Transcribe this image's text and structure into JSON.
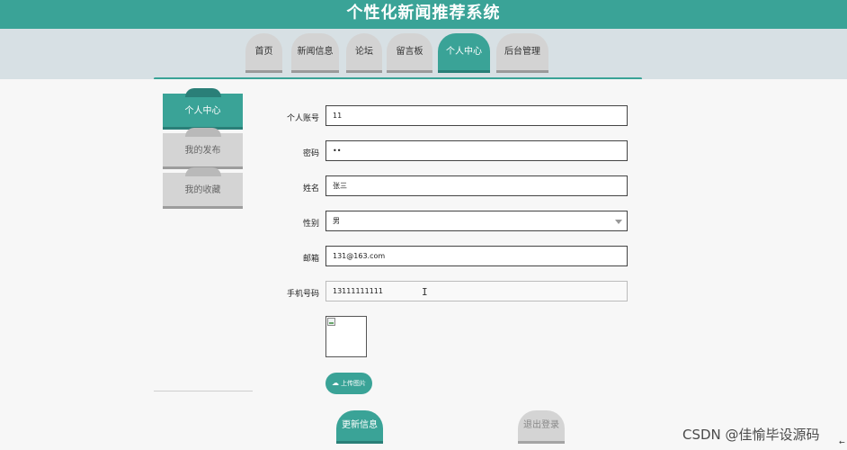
{
  "header": {
    "title": "个性化新闻推荐系统"
  },
  "nav": {
    "tabs": [
      {
        "label": "首页",
        "active": false
      },
      {
        "label": "新闻信息",
        "active": false
      },
      {
        "label": "论坛",
        "active": false
      },
      {
        "label": "留言板",
        "active": false
      },
      {
        "label": "个人中心",
        "active": true
      },
      {
        "label": "后台管理",
        "active": false
      }
    ]
  },
  "sidebar": {
    "items": [
      {
        "label": "个人中心",
        "active": true
      },
      {
        "label": "我的发布",
        "active": false
      },
      {
        "label": "我的收藏",
        "active": false
      }
    ]
  },
  "form": {
    "account": {
      "label": "个人账号",
      "value": "11"
    },
    "password": {
      "label": "密码",
      "value": "••"
    },
    "name": {
      "label": "姓名",
      "value": "张三"
    },
    "gender": {
      "label": "性别",
      "value": "男"
    },
    "email": {
      "label": "邮箱",
      "value": "131@163.com"
    },
    "phone": {
      "label": "手机号码",
      "value": "13111111111"
    }
  },
  "actions": {
    "upload_label": "上传图片",
    "update_label": "更新信息",
    "logout_label": "退出登录"
  },
  "watermark": "CSDN @佳愉毕设源码",
  "colors": {
    "accent": "#3aa397",
    "inactive": "#d4d4d4",
    "nav_band": "#d7e0e4"
  },
  "icons": {
    "upload": "cloud-upload-icon",
    "select": "chevron-down-icon",
    "avatar": "broken-image-icon"
  }
}
